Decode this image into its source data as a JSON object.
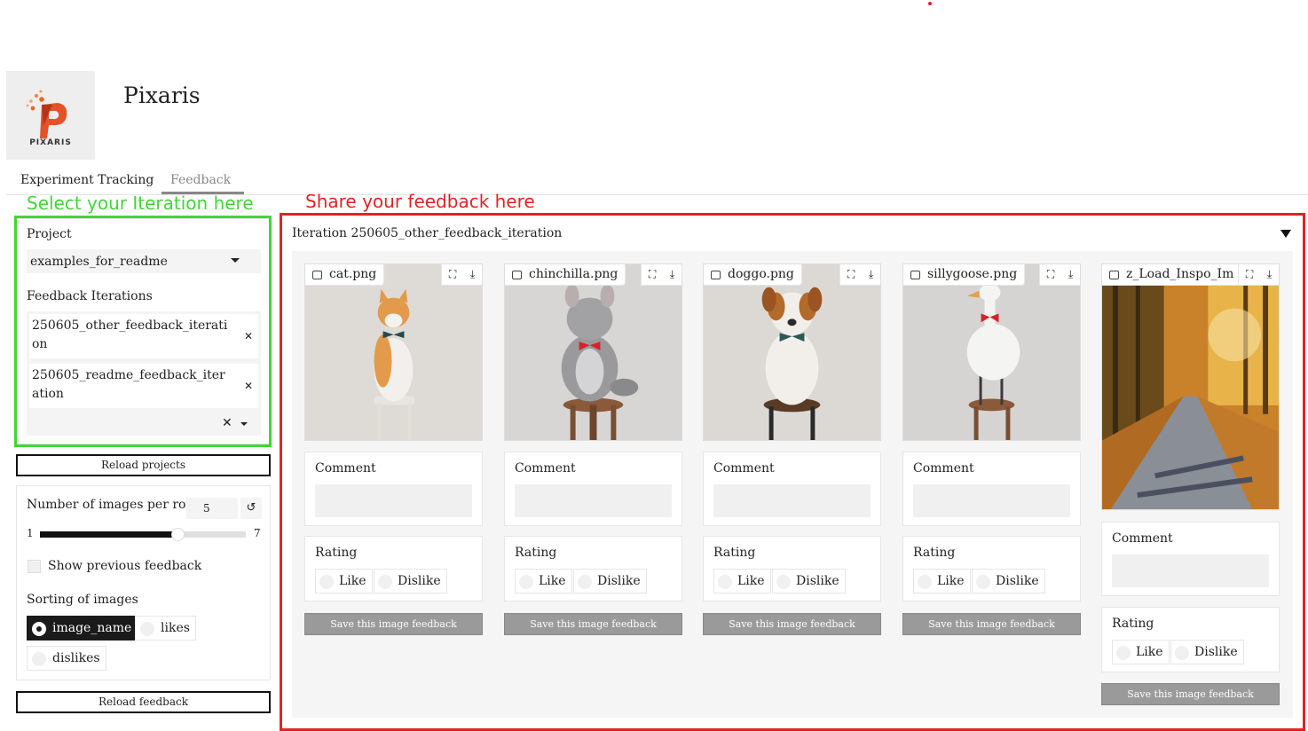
{
  "app": {
    "title": "Pixaris",
    "logo_text": "PIXARIS"
  },
  "tabs": [
    {
      "label": "Experiment Tracking",
      "active": false
    },
    {
      "label": "Feedback",
      "active": true
    }
  ],
  "annotations": {
    "select": "Select your Iteration here",
    "share": "Share your feedback here",
    "select_color": "#44d43a",
    "share_color": "#e02424"
  },
  "sidebar": {
    "project_label": "Project",
    "project_value": "examples_for_readme",
    "iterations_label": "Feedback Iterations",
    "iterations": [
      "250605_other_feedback_iteration",
      "250605_readme_feedback_iteration"
    ],
    "clear_icon": "close-icon",
    "reload_projects": "Reload projects",
    "images_per_row_label": "Number of images per row",
    "images_per_row_value": "5",
    "slider_min": "1",
    "slider_max": "7",
    "show_previous_label": "Show previous feedback",
    "show_previous_checked": false,
    "sorting_label": "Sorting of images",
    "sorting_options": [
      "image_name",
      "likes",
      "dislikes"
    ],
    "sorting_selected": "image_name",
    "reload_feedback": "Reload feedback"
  },
  "main": {
    "iteration_header": "Iteration 250605_other_feedback_iteration",
    "comment_label": "Comment",
    "rating_label": "Rating",
    "like_label": "Like",
    "dislike_label": "Dislike",
    "save_label": "Save this image feedback",
    "images": [
      {
        "name": "cat.png"
      },
      {
        "name": "chinchilla.png"
      },
      {
        "name": "doggo.png"
      },
      {
        "name": "sillygoose.png"
      },
      {
        "name": "z_Load_Inspo_Im"
      }
    ]
  }
}
